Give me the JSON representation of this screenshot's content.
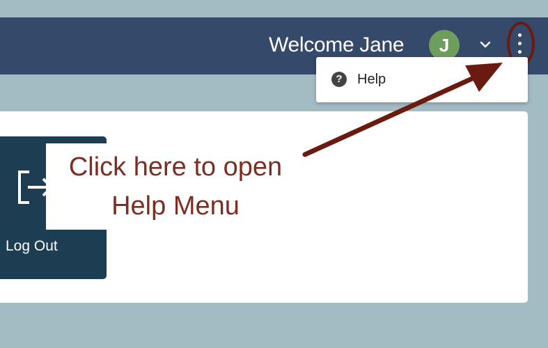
{
  "header": {
    "welcome_text": "Welcome Jane",
    "avatar_initial": "J"
  },
  "menu": {
    "items": [
      {
        "label": "Help",
        "icon": "?"
      }
    ]
  },
  "logout": {
    "label": "Log Out",
    "icon": "logout-icon"
  },
  "annotation": {
    "line1": "Click here to open",
    "line2": "Help Menu"
  },
  "colors": {
    "page_background": "#a3bcc4",
    "header_background": "#35496b",
    "avatar": "#6e9e5e",
    "logout_tile": "#1d3d52",
    "annotation": "#7a2f22",
    "arrow": "#6b1a10"
  }
}
